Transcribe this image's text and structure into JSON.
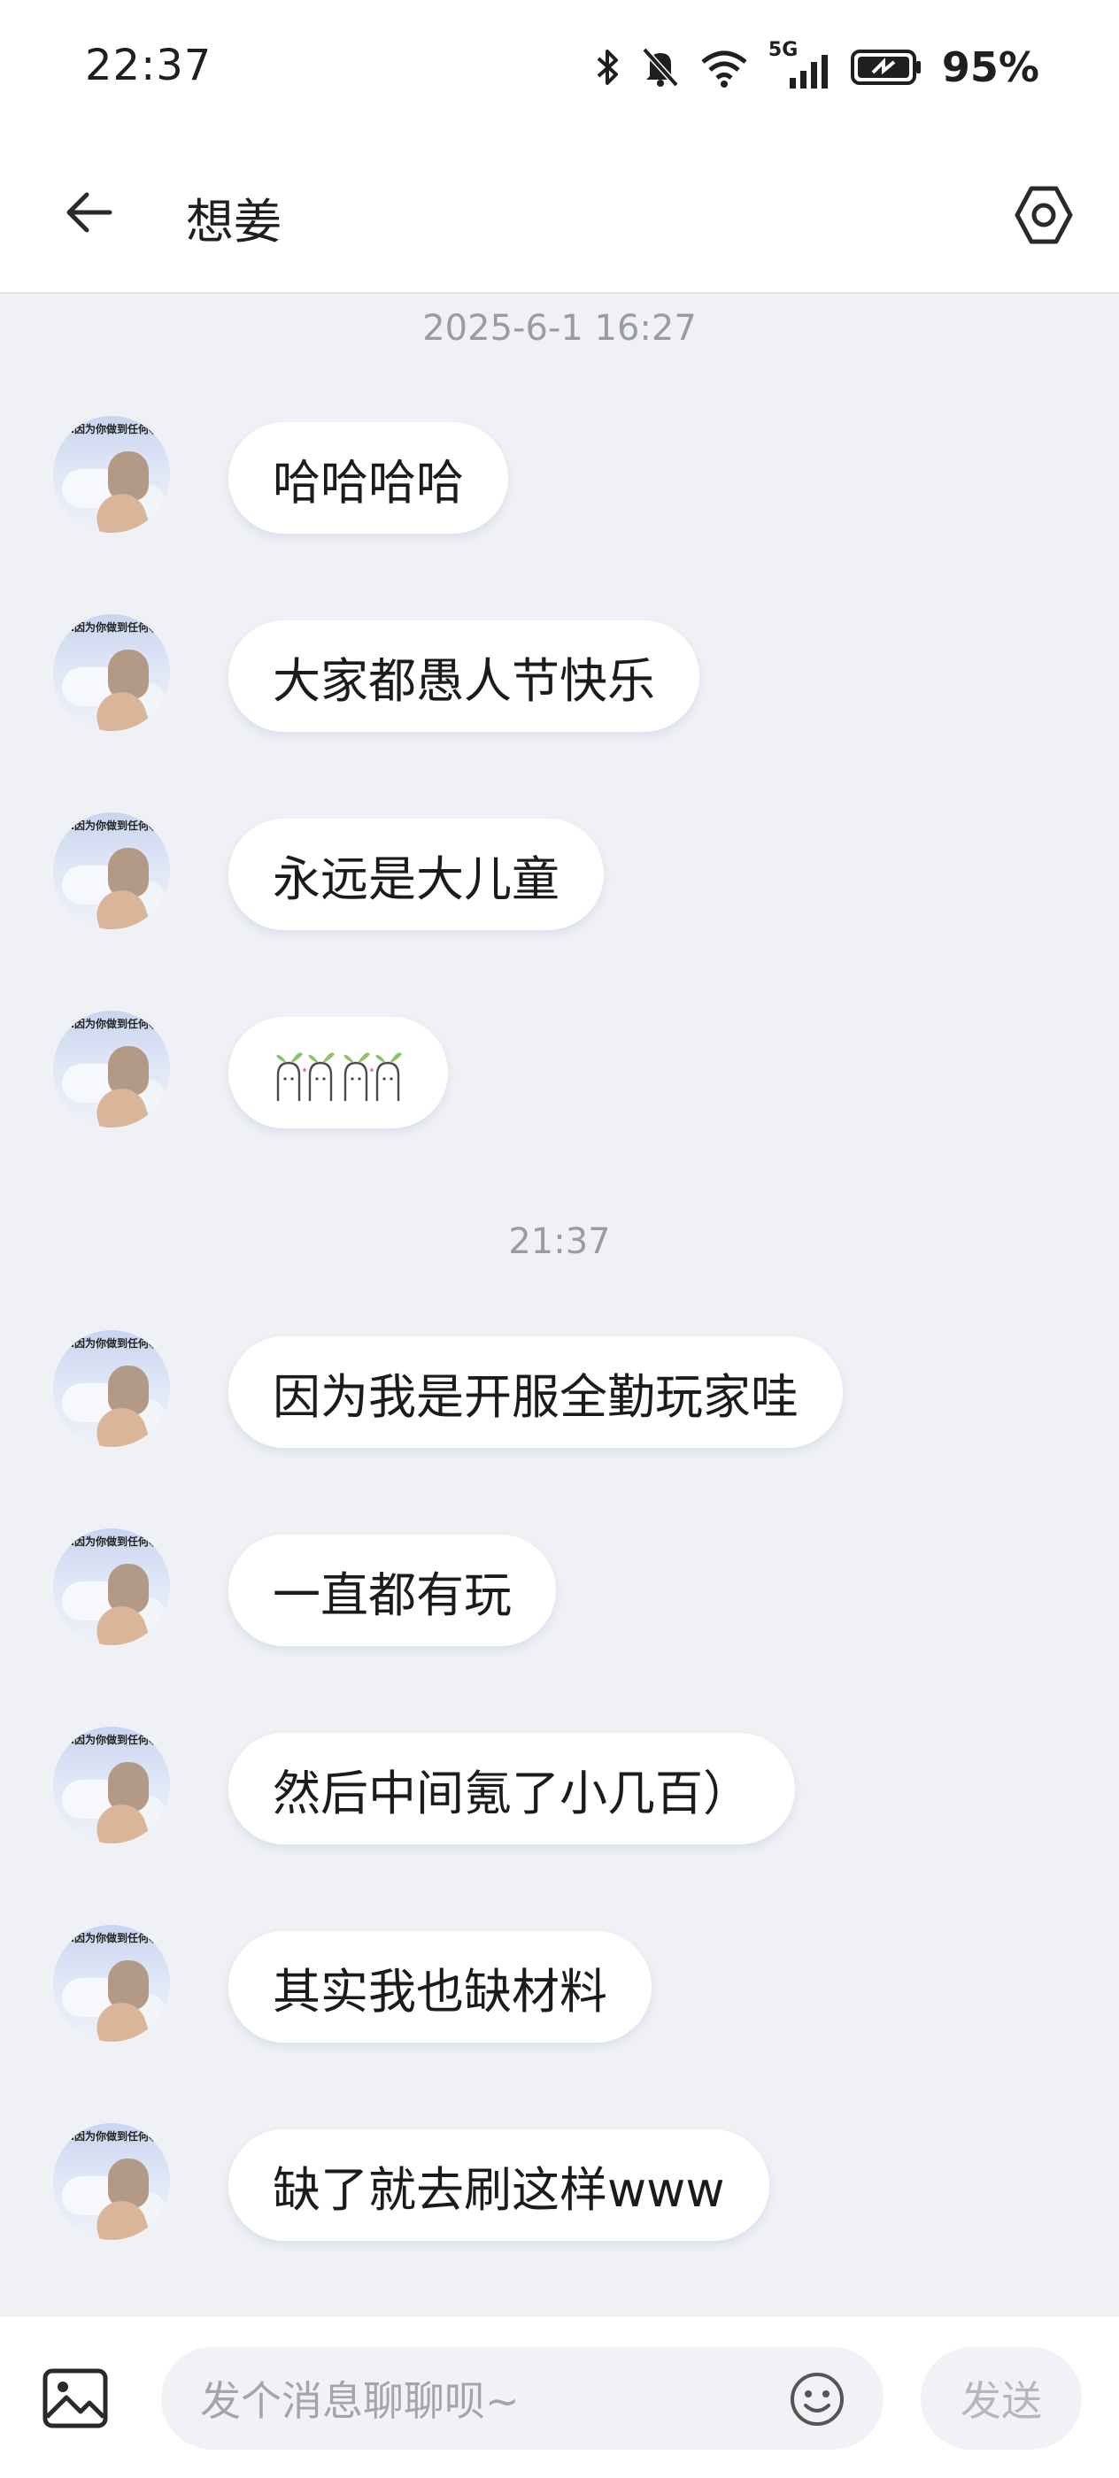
{
  "status_bar": {
    "time": "22:37",
    "network": "5G",
    "battery": "95%",
    "icons": [
      "bluetooth-icon",
      "mute-bell-icon",
      "wifi-icon",
      "cellular-signal-icon",
      "battery-saver-icon"
    ]
  },
  "header": {
    "title": "想姜",
    "back_icon": "back-arrow-icon",
    "settings_icon": "settings-hexagon-icon"
  },
  "messages": {
    "timestamp_1": "2025-6-1 16:27",
    "timestamp_2": "21:37",
    "m1": "哈哈哈哈",
    "m2": "大家都愚人节快乐",
    "m3": "永远是大儿童",
    "m4_sticker": "carrot-bunny-sticker",
    "m5": "因为我是开服全勤玩家哇",
    "m6": "一直都有玩",
    "m7": "然后中间氪了小几百）",
    "m8": "其实我也缺材料",
    "m9": "缺了就去刷这样www"
  },
  "avatar": {
    "caption": "…因为你做到任何事"
  },
  "composer": {
    "placeholder": "发个消息聊聊呗~",
    "send_label": "发送",
    "image_icon": "image-icon",
    "emoji_icon": "emoji-icon"
  },
  "colors": {
    "background": "#f0f1f4",
    "bubble": "#ffffff",
    "timestamp": "#9a9ca3"
  }
}
